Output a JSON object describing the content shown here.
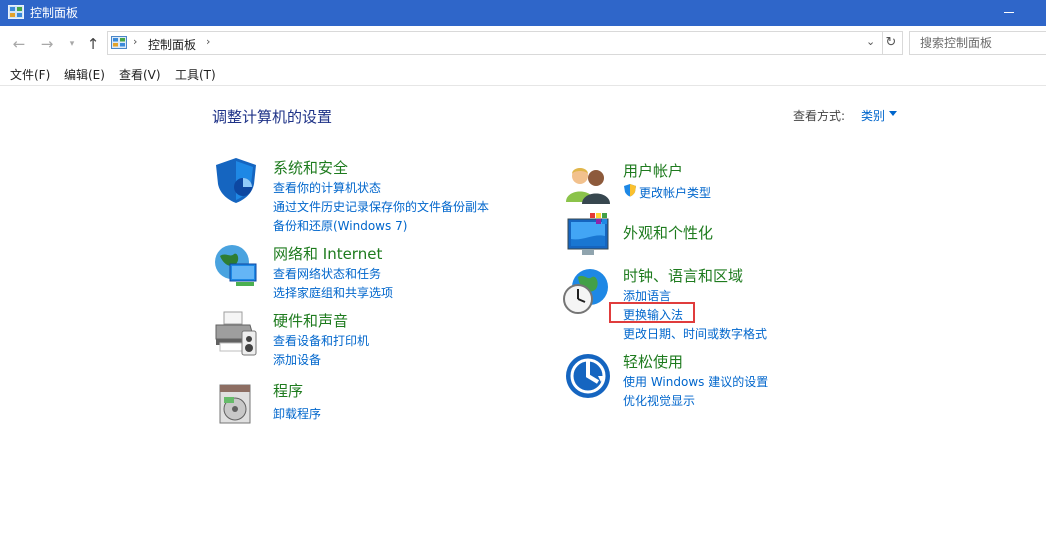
{
  "window": {
    "title": "控制面板"
  },
  "nav": {
    "back_icon": "back-arrow-icon",
    "forward_icon": "forward-arrow-icon",
    "recent_icon": "chevron-down-icon",
    "up_icon": "up-arrow-icon",
    "breadcrumb": [
      "控制面板"
    ],
    "refresh_icon": "refresh-icon",
    "search_placeholder": "搜索控制面板"
  },
  "menu": [
    "文件(F)",
    "编辑(E)",
    "查看(V)",
    "工具(T)"
  ],
  "main": {
    "heading": "调整计算机的设置",
    "view_by_label": "查看方式:",
    "view_by_value": "类别"
  },
  "categories": [
    {
      "title": "系统和安全",
      "icon": "shield-icon",
      "links": [
        "查看你的计算机状态",
        "通过文件历史记录保存你的文件备份副本",
        "备份和还原(Windows 7)"
      ]
    },
    {
      "title": "网络和 Internet",
      "icon": "network-icon",
      "links": [
        "查看网络状态和任务",
        "选择家庭组和共享选项"
      ]
    },
    {
      "title": "硬件和声音",
      "icon": "printer-icon",
      "links": [
        "查看设备和打印机",
        "添加设备"
      ]
    },
    {
      "title": "程序",
      "icon": "programs-icon",
      "links": [
        "卸载程序"
      ]
    },
    {
      "title": "用户帐户",
      "icon": "users-icon",
      "links": [
        "更改帐户类型"
      ]
    },
    {
      "title": "外观和个性化",
      "icon": "monitor-icon",
      "links": []
    },
    {
      "title": "时钟、语言和区域",
      "icon": "clock-globe-icon",
      "links": [
        "添加语言",
        "更换输入法",
        "更改日期、时间或数字格式"
      ]
    },
    {
      "title": "轻松使用",
      "icon": "ease-of-access-icon",
      "links": [
        "使用 Windows 建议的设置",
        "优化视觉显示"
      ]
    }
  ],
  "colors": {
    "titlebar": "#2f66c9",
    "heading": "#1e3287",
    "category_title": "#1e7b1e",
    "link": "#0066cc",
    "highlight_box": "#e03c3c"
  }
}
